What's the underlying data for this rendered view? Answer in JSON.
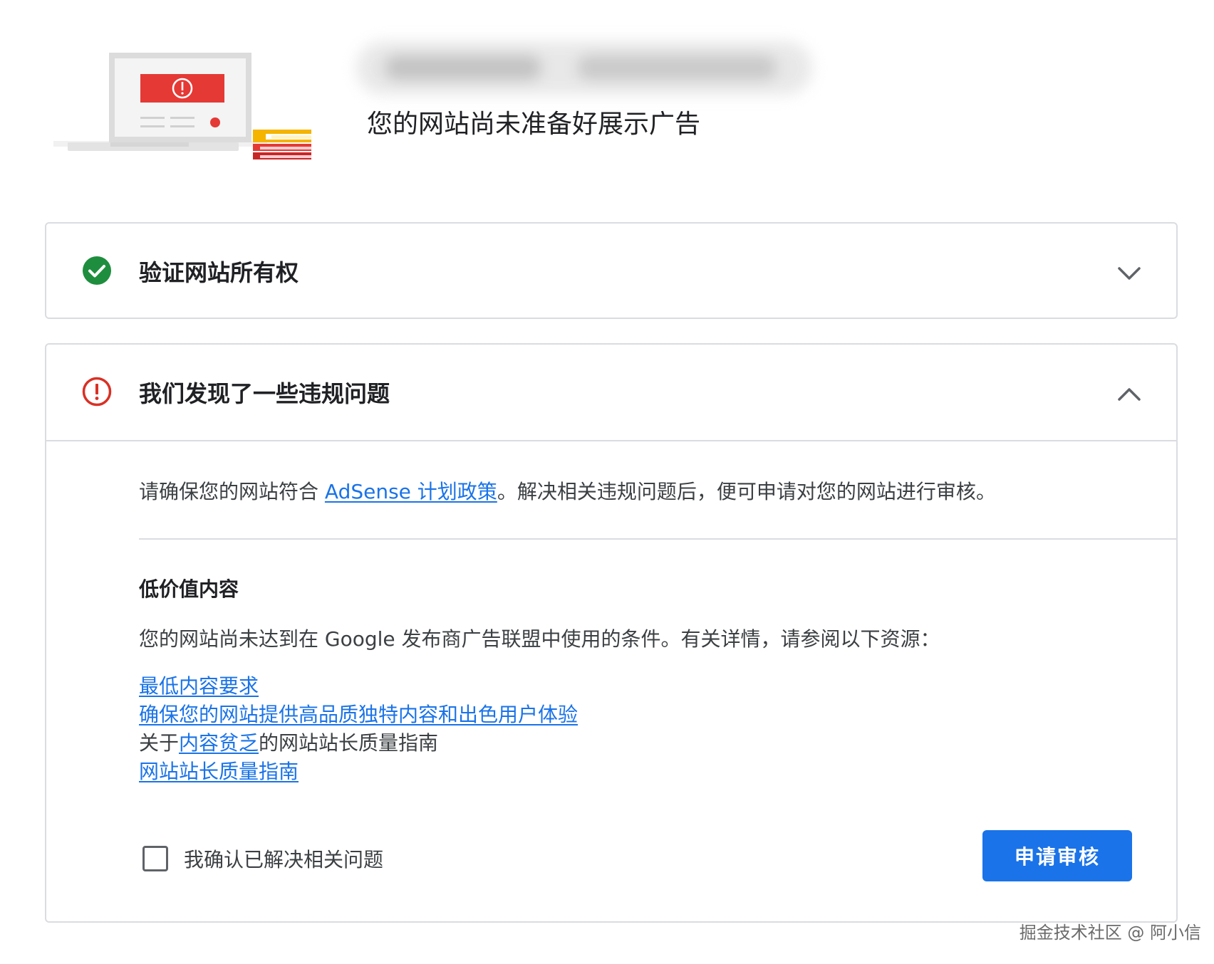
{
  "header": {
    "title": "您的网站尚未准备好展示广告"
  },
  "steps": [
    {
      "title": "验证网站所有权",
      "status_icon": "check-circle-icon",
      "status_color": "#1e8e3e",
      "toggle_icon": "chevron-down-icon"
    },
    {
      "title": "我们发现了一些违规问题",
      "status_icon": "error-circle-icon",
      "status_color": "#d93025",
      "toggle_icon": "chevron-up-icon",
      "intro": {
        "before": "请确保您的网站符合 ",
        "link": "AdSense 计划政策",
        "after": "。解决相关违规问题后，便可申请对您的网站进行审核。"
      },
      "section": {
        "title": "低价值内容",
        "description": "您的网站尚未达到在 Google 发布商广告联盟中使用的条件。有关详情，请参阅以下资源：",
        "resources": [
          {
            "link": "最低内容要求"
          },
          {
            "link": "确保您的网站提供高品质独特内容和出色用户体验"
          },
          {
            "prefix": "关于",
            "link": "内容贫乏",
            "suffix": "的网站站长质量指南"
          },
          {
            "link": "网站站长质量指南"
          }
        ]
      },
      "acknowledge_label": "我确认已解决相关问题",
      "acknowledge_checked": false,
      "submit_label": "申请审核"
    }
  ],
  "colors": {
    "link": "#1a73e8",
    "primary_button": "#1a73e8",
    "border": "#dadce0"
  },
  "watermark": "掘金技术社区 @ 阿小信"
}
